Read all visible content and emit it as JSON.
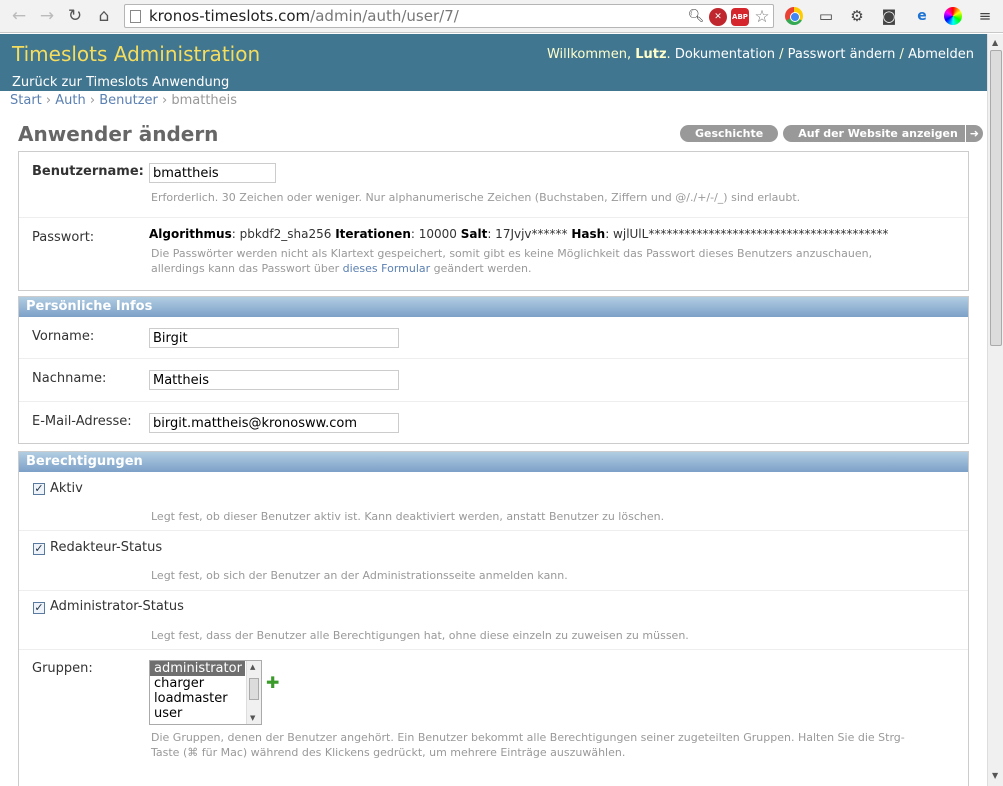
{
  "browser": {
    "url_host": "kronos-timeslots.com",
    "url_path": "/admin/auth/user/7/"
  },
  "header": {
    "branding": "Timeslots Administration",
    "back_link": "Zurück zur Timeslots Anwendung",
    "welcome": "Willkommen, ",
    "user": "Lutz",
    "docs": "Dokumentation",
    "change_password": "Passwort ändern",
    "logout": "Abmelden"
  },
  "breadcrumbs": {
    "start": "Start",
    "auth": "Auth",
    "users": "Benutzer",
    "current": "bmattheis",
    "sep": "›"
  },
  "page": {
    "title": "Anwender ändern",
    "history_button": "Geschichte",
    "view_on_site_button": "Auf der Website anzeigen"
  },
  "account": {
    "username_label": "Benutzername:",
    "username_value": "bmattheis",
    "username_help": "Erforderlich. 30 Zeichen oder weniger. Nur alphanumerische Zeichen (Buchstaben, Ziffern und @/./+/-/_) sind erlaubt.",
    "password_label": "Passwort:",
    "pwd_algorithm_label": "Algorithmus",
    "pwd_algorithm": ": pbkdf2_sha256 ",
    "pwd_iterations_label": "Iterationen",
    "pwd_iterations": ": 10000 ",
    "pwd_salt_label": "Salt",
    "pwd_salt": ": 17Jvjv****** ",
    "pwd_hash_label": "Hash",
    "pwd_hash": ": wjlUlL****************************************",
    "password_help_1": "Die Passwörter werden nicht als Klartext gespeichert, somit gibt es keine Möglichkeit das Passwort dieses Benutzers anzuschauen,",
    "password_help_2": "allerdings kann das Passwort über ",
    "password_help_link": "dieses Formular",
    "password_help_3": " geändert werden."
  },
  "personal": {
    "heading": "Persönliche Infos",
    "first_name_label": "Vorname:",
    "first_name_value": "Birgit",
    "last_name_label": "Nachname:",
    "last_name_value": "Mattheis",
    "email_label": "E-Mail-Adresse:",
    "email_value": "birgit.mattheis@kronosww.com"
  },
  "permissions": {
    "heading": "Berechtigungen",
    "active_label": "Aktiv",
    "active_help": "Legt fest, ob dieser Benutzer aktiv ist. Kann deaktiviert werden, anstatt Benutzer zu löschen.",
    "staff_label": "Redakteur-Status",
    "staff_help": "Legt fest, ob sich der Benutzer an der Administrationsseite anmelden kann.",
    "superuser_label": "Administrator-Status",
    "superuser_help": "Legt fest, dass der Benutzer alle Berechtigungen hat, ohne diese einzeln zu zuweisen zu müssen.",
    "checked": "✓",
    "groups_label": "Gruppen:",
    "groups_options": [
      "administrator",
      "charger",
      "loadmaster",
      "user"
    ],
    "groups_help_1": "Die Gruppen, denen der Benutzer angehört. Ein Benutzer bekommt alle Berechtigungen seiner zugeteilten Gruppen. Halten Sie die Strg-",
    "groups_help_2": "Taste (⌘ für Mac) während des Klickens gedrückt, um mehrere Einträge auszuwählen."
  }
}
